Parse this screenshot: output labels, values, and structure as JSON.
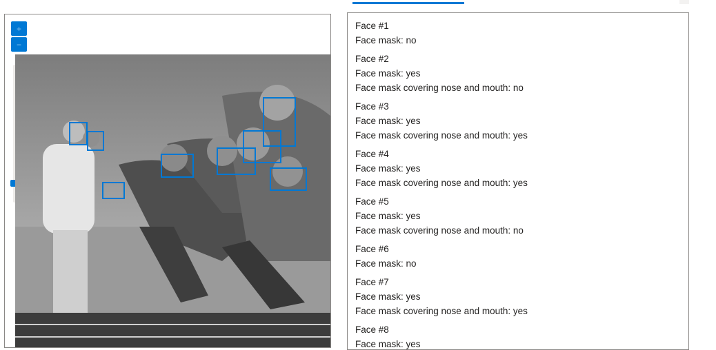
{
  "viewer": {
    "zoom_in_icon": "plus-icon",
    "zoom_out_icon": "minus-icon",
    "zoom_level": 0.2,
    "image_colors": {
      "face_box": "#0078d4"
    }
  },
  "results": {
    "faces": [
      {
        "title": "Face #1",
        "mask": "Face mask: no",
        "covering": ""
      },
      {
        "title": "Face #2",
        "mask": "Face mask: yes",
        "covering": "Face mask covering nose and mouth: no"
      },
      {
        "title": "Face #3",
        "mask": "Face mask: yes",
        "covering": "Face mask covering nose and mouth: yes"
      },
      {
        "title": "Face #4",
        "mask": "Face mask: yes",
        "covering": "Face mask covering nose and mouth: yes"
      },
      {
        "title": "Face #5",
        "mask": "Face mask: yes",
        "covering": "Face mask covering nose and mouth: no"
      },
      {
        "title": "Face #6",
        "mask": "Face mask: no",
        "covering": ""
      },
      {
        "title": "Face #7",
        "mask": "Face mask: yes",
        "covering": "Face mask covering nose and mouth: yes"
      },
      {
        "title": "Face #8",
        "mask": "Face mask: yes",
        "covering": ""
      }
    ]
  },
  "colors": {
    "accent": "#0078d4",
    "border": "#8a8886",
    "text": "#201f1e"
  }
}
